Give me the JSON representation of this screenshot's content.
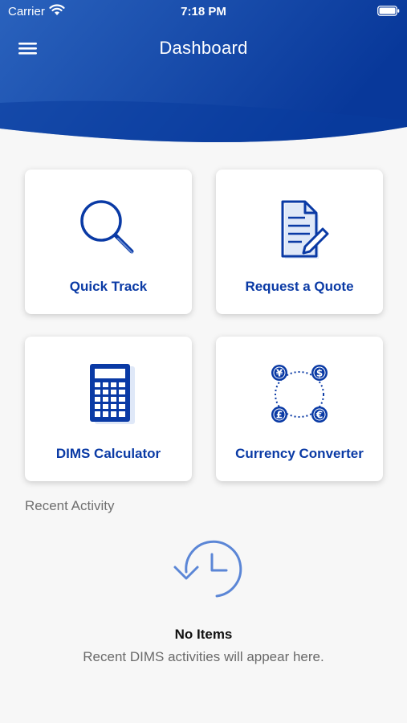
{
  "status_bar": {
    "carrier": "Carrier",
    "time": "7:18 PM"
  },
  "header": {
    "title": "Dashboard",
    "menu_icon": "hamburger-menu-icon",
    "background": "#1a4ea8"
  },
  "tiles": [
    {
      "label": "Quick Track",
      "icon": "magnifier-icon"
    },
    {
      "label": "Request a Quote",
      "icon": "document-pen-icon"
    },
    {
      "label": "DIMS Calculator",
      "icon": "calculator-icon"
    },
    {
      "label": "Currency Converter",
      "icon": "currency-exchange-icon"
    }
  ],
  "recent_activity": {
    "label": "Recent Activity",
    "empty_icon": "history-clock-icon",
    "empty_title": "No Items",
    "empty_description": "Recent DIMS activities will appear here."
  },
  "colors": {
    "accent": "#0a3aa5",
    "header_dark": "#083896",
    "header_light": "#2a62bd",
    "background": "#f7f7f7"
  }
}
